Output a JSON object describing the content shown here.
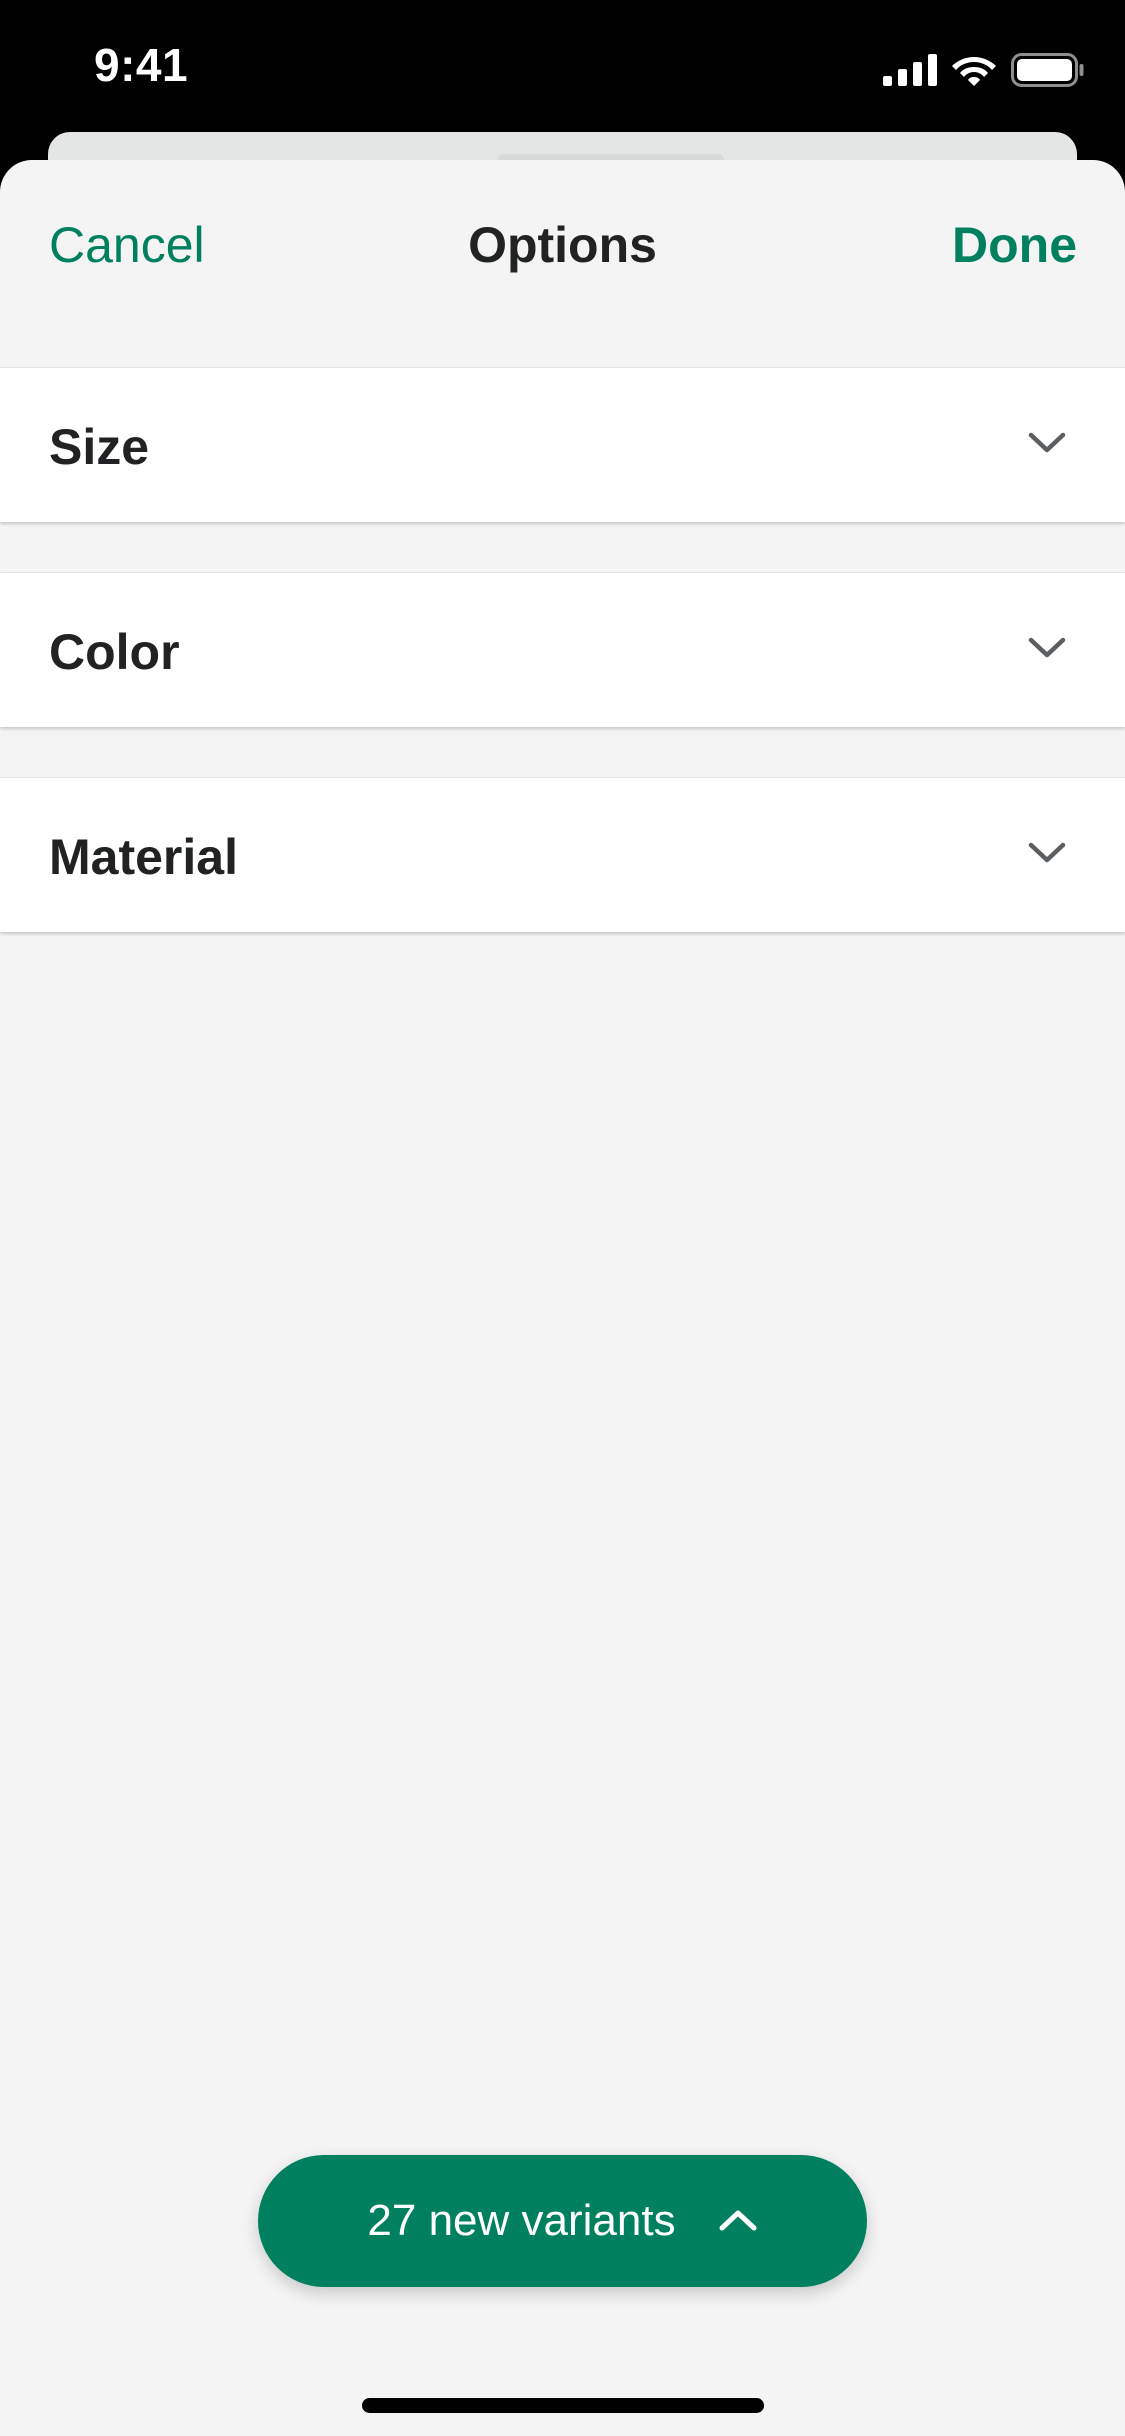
{
  "status_bar": {
    "time": "9:41",
    "icons": [
      "cellular-signal-icon",
      "wifi-icon",
      "battery-icon"
    ]
  },
  "nav": {
    "cancel_label": "Cancel",
    "title": "Options",
    "done_label": "Done"
  },
  "options": [
    {
      "label": "Size",
      "icon": "chevron-down-icon"
    },
    {
      "label": "Color",
      "icon": "chevron-down-icon"
    },
    {
      "label": "Material",
      "icon": "chevron-down-icon"
    }
  ],
  "variants_button": {
    "label": "27 new variants",
    "icon": "chevron-up-icon"
  },
  "colors": {
    "accent": "#00805f",
    "background": "#f4f4f4",
    "text": "#202223"
  }
}
